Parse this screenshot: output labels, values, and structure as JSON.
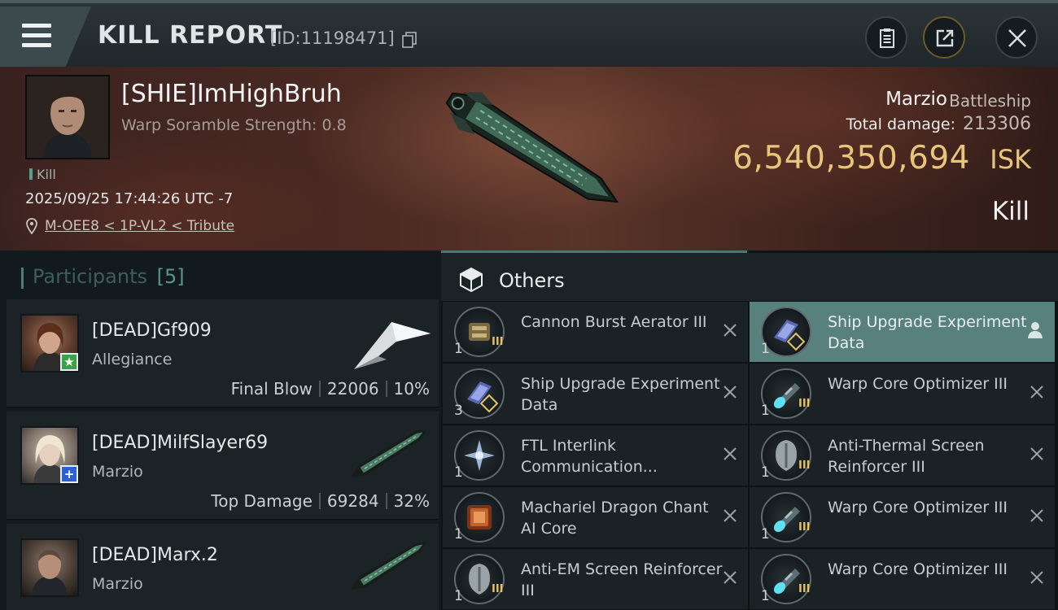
{
  "titlebar": {
    "title": "KILL REPORT",
    "report_id": "[ID:11198471]",
    "icons": [
      "menu-icon",
      "copy-icon",
      "report-icon",
      "share-icon",
      "close-icon"
    ]
  },
  "victim": {
    "name": "[SHIE]ImHighBruh",
    "subtitle": "Warp Soramble Strength: 0.8",
    "tag": "Kill",
    "timestamp": "2025/09/25 17:44:26 UTC -7",
    "location": "M-OEE8 < 1P-VL2 < Tribute",
    "ship_name": "Marzio",
    "ship_class": "Battleship",
    "damage_label": "Total damage:",
    "damage_value": "213306",
    "isk_value": "6,540,350,694",
    "isk_unit": "ISK",
    "result": "Kill"
  },
  "participants": {
    "label": "Participants",
    "count": "[5]",
    "list": [
      {
        "name": "[DEAD]Gf909",
        "ship": "Allegiance",
        "role": "Final Blow",
        "damage": "22006",
        "percent": "10%",
        "badge": "star",
        "badge_color": "#3aa34a"
      },
      {
        "name": "[DEAD]MilfSlayer69",
        "ship": "Marzio",
        "role": "Top Damage",
        "damage": "69284",
        "percent": "32%",
        "badge": "plus",
        "badge_color": "#2f5fd1"
      },
      {
        "name": "[DEAD]Marx.2",
        "ship": "Marzio"
      }
    ]
  },
  "items": {
    "tab_label": "Others",
    "left": [
      {
        "qty": "1",
        "name": "Cannon Burst Aerator III",
        "tier": "III",
        "icon": "cannon-aerator-icon"
      },
      {
        "qty": "3",
        "name": "Ship Upgrade Experiment Data",
        "tier": "A",
        "icon": "data-chip-icon"
      },
      {
        "qty": "1",
        "name": "FTL Interlink Communication...",
        "icon": "interlink-icon"
      },
      {
        "qty": "1",
        "name": "Machariel Dragon Chant AI Core",
        "icon": "ai-core-icon"
      },
      {
        "qty": "1",
        "name": "Anti-EM Screen Reinforcer III",
        "tier": "III",
        "icon": "shield-reinforcer-icon"
      }
    ],
    "right": [
      {
        "qty": "1",
        "name": "Ship Upgrade Experiment Data",
        "tier": "A",
        "icon": "data-chip-icon",
        "selected": true
      },
      {
        "qty": "1",
        "name": "Warp Core Optimizer III",
        "tier": "III",
        "icon": "warp-core-icon"
      },
      {
        "qty": "1",
        "name": "Anti-Thermal Screen Reinforcer III",
        "tier": "III",
        "icon": "shield-reinforcer-icon"
      },
      {
        "qty": "1",
        "name": "Warp Core Optimizer III",
        "tier": "III",
        "icon": "warp-core-icon"
      },
      {
        "qty": "1",
        "name": "Warp Core Optimizer III",
        "tier": "III",
        "icon": "warp-core-icon"
      }
    ]
  }
}
